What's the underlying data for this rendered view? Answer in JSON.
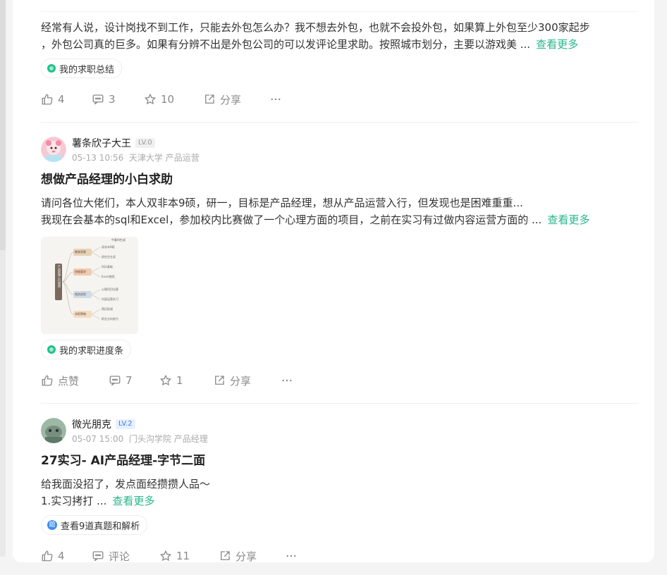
{
  "posts": [
    {
      "body_line1": "经常有人说，设计岗找不到工作，只能去外包怎么办？我不想去外包，也就不会投外包，如果算上外包至少300家起步",
      "body_line2": "，外包公司真的巨多。如果有分辨不出是外包公司的可以发评论里求助。按照城市划分，主要以游戏美 ...",
      "more": "查看更多",
      "tag": "我的求职总结",
      "actions": {
        "like": "4",
        "comment": "3",
        "star": "10",
        "share": "分享"
      }
    },
    {
      "author": "薯条欣子大王",
      "level": "LV.0",
      "time": "05-13 10:56",
      "school": "天津大学",
      "role": "产品运营",
      "title": "想做产品经理的小白求助",
      "body_line1": "请问各位大佬们，本人双非本9硕，研一，目标是产品经理，想从产品运营入行，但发现也是困难重重...",
      "body_line2": "我现在会基本的sql和Excel，参加校内比赛做了一个心理方面的项目，之前在实习有过做内容运营方面的 ...",
      "more": "查看更多",
      "tag": "我的求职进度条",
      "actions": {
        "like": "点赞",
        "comment": "7",
        "star": "1",
        "share": "分享"
      },
      "mindmap": {
        "root": "产品经理入行规划",
        "badge": "牛客AI生成",
        "branches": [
          {
            "label": "教育背景",
            "color": "#e8d2b6",
            "leaves": [
              "双非本9硕",
              "研究生在读"
            ]
          },
          {
            "label": "技能要求",
            "color": "#f3c9b2",
            "leaves": [
              "SQL基础",
              "Excel使用"
            ]
          },
          {
            "label": "相关经验",
            "color": "#cfdde9",
            "leaves": [
              "心理项目比赛",
              "内容运营实习"
            ]
          },
          {
            "label": "求职策略",
            "color": "#f5dcc0",
            "leaves": [
              "简历投递",
              "职业方向努力"
            ]
          }
        ]
      }
    },
    {
      "author": "微光朋克",
      "level": "LV.2",
      "time": "05-07 15:00",
      "school": "门头沟学院",
      "role": "产品经理",
      "title": "27实习- AI产品经理-字节二面",
      "body_line1": "给我面没招了，发点面经攒攒人品～",
      "body_line2": "1.实习拷打 ...",
      "more": "查看更多",
      "tag": "查看9道真题和解析",
      "tag_icon_text": "题",
      "actions": {
        "like": "4",
        "comment": "评论",
        "star": "11",
        "share": "分享"
      }
    }
  ],
  "colors": {
    "accent": "#26b58a",
    "muted": "#8a8a8a"
  }
}
